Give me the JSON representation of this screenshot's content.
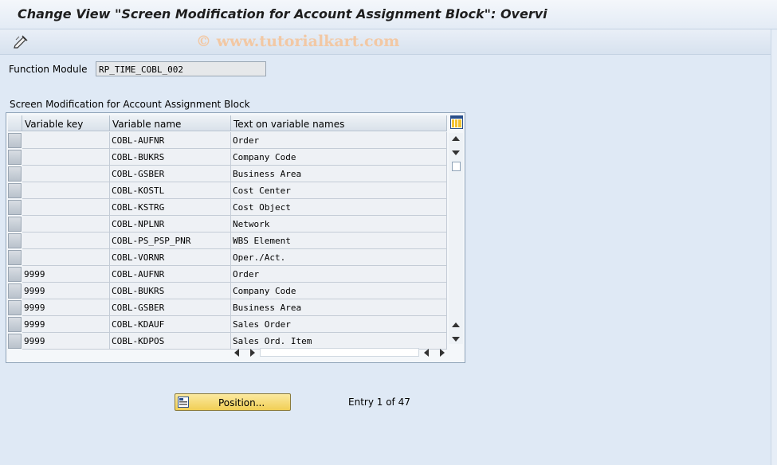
{
  "window": {
    "title": "Change View \"Screen Modification for Account Assignment Block\": Overvi",
    "watermark": "© www.tutorialkart.com"
  },
  "toolbar": {
    "icons": [
      "display-change-icon"
    ]
  },
  "form": {
    "function_module_label": "Function Module",
    "function_module_value": "RP_TIME_COBL_002"
  },
  "table": {
    "caption": "Screen Modification for Account Assignment Block",
    "columns": [
      "Variable key",
      "Variable name",
      "Text on variable names"
    ],
    "rows": [
      [
        "",
        "COBL-AUFNR",
        "Order"
      ],
      [
        "",
        "COBL-BUKRS",
        "Company Code"
      ],
      [
        "",
        "COBL-GSBER",
        "Business Area"
      ],
      [
        "",
        "COBL-KOSTL",
        "Cost Center"
      ],
      [
        "",
        "COBL-KSTRG",
        "Cost Object"
      ],
      [
        "",
        "COBL-NPLNR",
        "Network"
      ],
      [
        "",
        "COBL-PS_PSP_PNR",
        "WBS Element"
      ],
      [
        "",
        "COBL-VORNR",
        "Oper./Act."
      ],
      [
        "9999",
        "COBL-AUFNR",
        "Order"
      ],
      [
        "9999",
        "COBL-BUKRS",
        "Company Code"
      ],
      [
        "9999",
        "COBL-GSBER",
        "Business Area"
      ],
      [
        "9999",
        "COBL-KDAUF",
        "Sales Order"
      ],
      [
        "9999",
        "COBL-KDPOS",
        "Sales Ord. Item"
      ]
    ]
  },
  "footer": {
    "position_button": "Position...",
    "entry_text": "Entry 1 of 47"
  }
}
